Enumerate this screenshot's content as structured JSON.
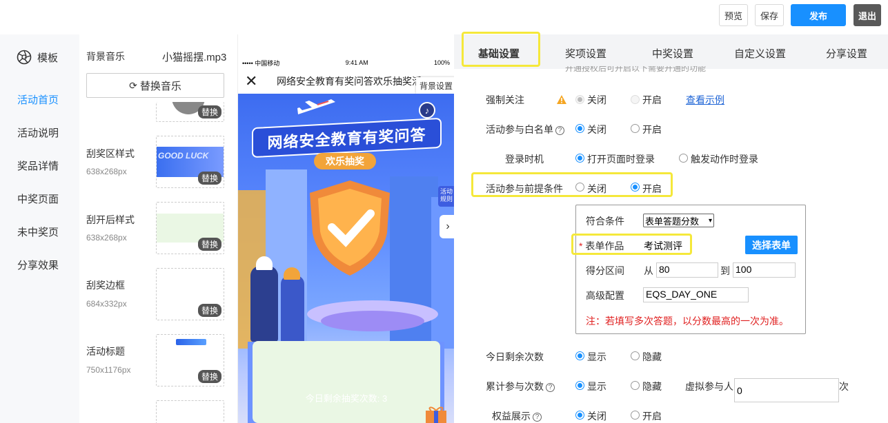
{
  "toolbar": {
    "preview_label": "预览",
    "save_label": "保存",
    "publish_label": "发布",
    "exit_label": "退出"
  },
  "sidebar": {
    "logo_label": "模板",
    "items": [
      {
        "label": "活动首页",
        "active": true
      },
      {
        "label": "活动说明",
        "active": false
      },
      {
        "label": "奖品详情",
        "active": false
      },
      {
        "label": "中奖页面",
        "active": false
      },
      {
        "label": "未中奖页",
        "active": false
      },
      {
        "label": "分享效果",
        "active": false
      }
    ]
  },
  "assets": {
    "bg_music_label": "背景音乐",
    "bg_music_file": "小猫摇摆.mp3",
    "replace_music_label": "替换音乐",
    "swap_label": "替换",
    "items": [
      {
        "label": "刮奖区样式",
        "size": "638x268px"
      },
      {
        "label": "刮开后样式",
        "size": "638x268px"
      },
      {
        "label": "刮奖边框",
        "size": "684x332px"
      },
      {
        "label": "活动标题",
        "size": "750x1176px"
      }
    ]
  },
  "phone": {
    "carrier": "••••• 中国移动",
    "time": "9:41 AM",
    "battery": "100%",
    "title": "网络安全教育有奖问答欢乐抽奖活",
    "bg_setting_label": "背景设置",
    "poster_title": "网络安全教育有奖问答",
    "poster_subtitle": "欢乐抽奖",
    "side_tag": "活动规则",
    "remaining_text": "今日剩余抽奖次数: 3"
  },
  "tabs": [
    {
      "label": "基础设置",
      "active": true
    },
    {
      "label": "奖项设置",
      "active": false
    },
    {
      "label": "中奖设置",
      "active": false
    },
    {
      "label": "自定义设置",
      "active": false
    },
    {
      "label": "分享设置",
      "active": false
    }
  ],
  "settings": {
    "cut_hint": "开通授权后可开启以下需要开通的功能",
    "force_follow": {
      "label": "强制关注",
      "off": "关闭",
      "on": "开启",
      "example_link": "查看示例"
    },
    "whitelist": {
      "label": "活动参与白名单",
      "off": "关闭",
      "on": "开启"
    },
    "login_timing": {
      "label": "登录时机",
      "opt1": "打开页面时登录",
      "opt2": "触发动作时登录"
    },
    "precondition": {
      "label": "活动参与前提条件",
      "off": "关闭",
      "on": "开启"
    },
    "condition_box": {
      "match_label": "符合条件",
      "match_value": "表单答题分数",
      "form_label": "表单作品",
      "form_value": "考试测评",
      "select_form_button": "选择表单",
      "score_label": "得分区间",
      "from_label": "从",
      "from_value": "80",
      "to_label": "到",
      "to_value": "100",
      "advanced_label": "高级配置",
      "advanced_value": "EQS_DAY_ONE",
      "note": "注：若填写多次答题，以分数最高的一次为准。"
    },
    "today_remaining": {
      "label": "今日剩余次数",
      "show": "显示",
      "hide": "隐藏"
    },
    "cumulative": {
      "label": "累计参与次数",
      "show": "显示",
      "hide": "隐藏",
      "virtual_label": "虚拟参与人",
      "virtual_value": "0",
      "unit": "次"
    },
    "benefits": {
      "label": "权益展示",
      "off": "关闭",
      "on": "开启"
    }
  },
  "colors": {
    "accent": "#1890ff",
    "highlight": "#f5e83a",
    "warning": "#f5a623",
    "danger": "#e02020"
  }
}
